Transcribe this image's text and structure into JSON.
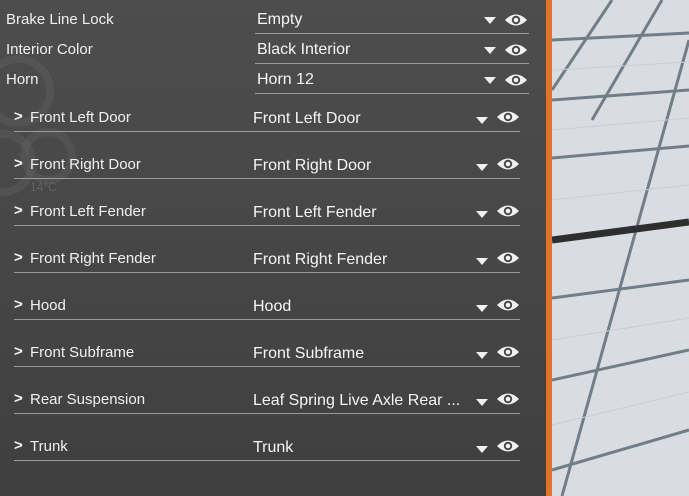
{
  "top_rows": [
    {
      "label": "Brake Line Lock",
      "value": "Empty"
    },
    {
      "label": "Interior Color",
      "value": "Black Interior"
    },
    {
      "label": "Horn",
      "value": "Horn 12"
    }
  ],
  "sub_rows": [
    {
      "label": "Front Left Door",
      "value": "Front Left Door"
    },
    {
      "label": "Front Right Door",
      "value": "Front Right Door"
    },
    {
      "label": "Front Left Fender",
      "value": "Front Left Fender"
    },
    {
      "label": "Front Right Fender",
      "value": "Front Right Fender"
    },
    {
      "label": "Hood",
      "value": "Hood"
    },
    {
      "label": "Front Subframe",
      "value": "Front Subframe"
    },
    {
      "label": "Rear Suspension",
      "value": "Leaf Spring Live Axle Rear ..."
    },
    {
      "label": "Trunk",
      "value": "Trunk"
    }
  ],
  "background_readout": "14°C",
  "icons": {
    "expand": "chevron-right-icon",
    "dropdown": "dropdown-arrow-icon",
    "visibility": "eye-icon"
  },
  "colors": {
    "accent": "#e8711f",
    "panel": "#484848",
    "text": "#f0f0f0"
  }
}
